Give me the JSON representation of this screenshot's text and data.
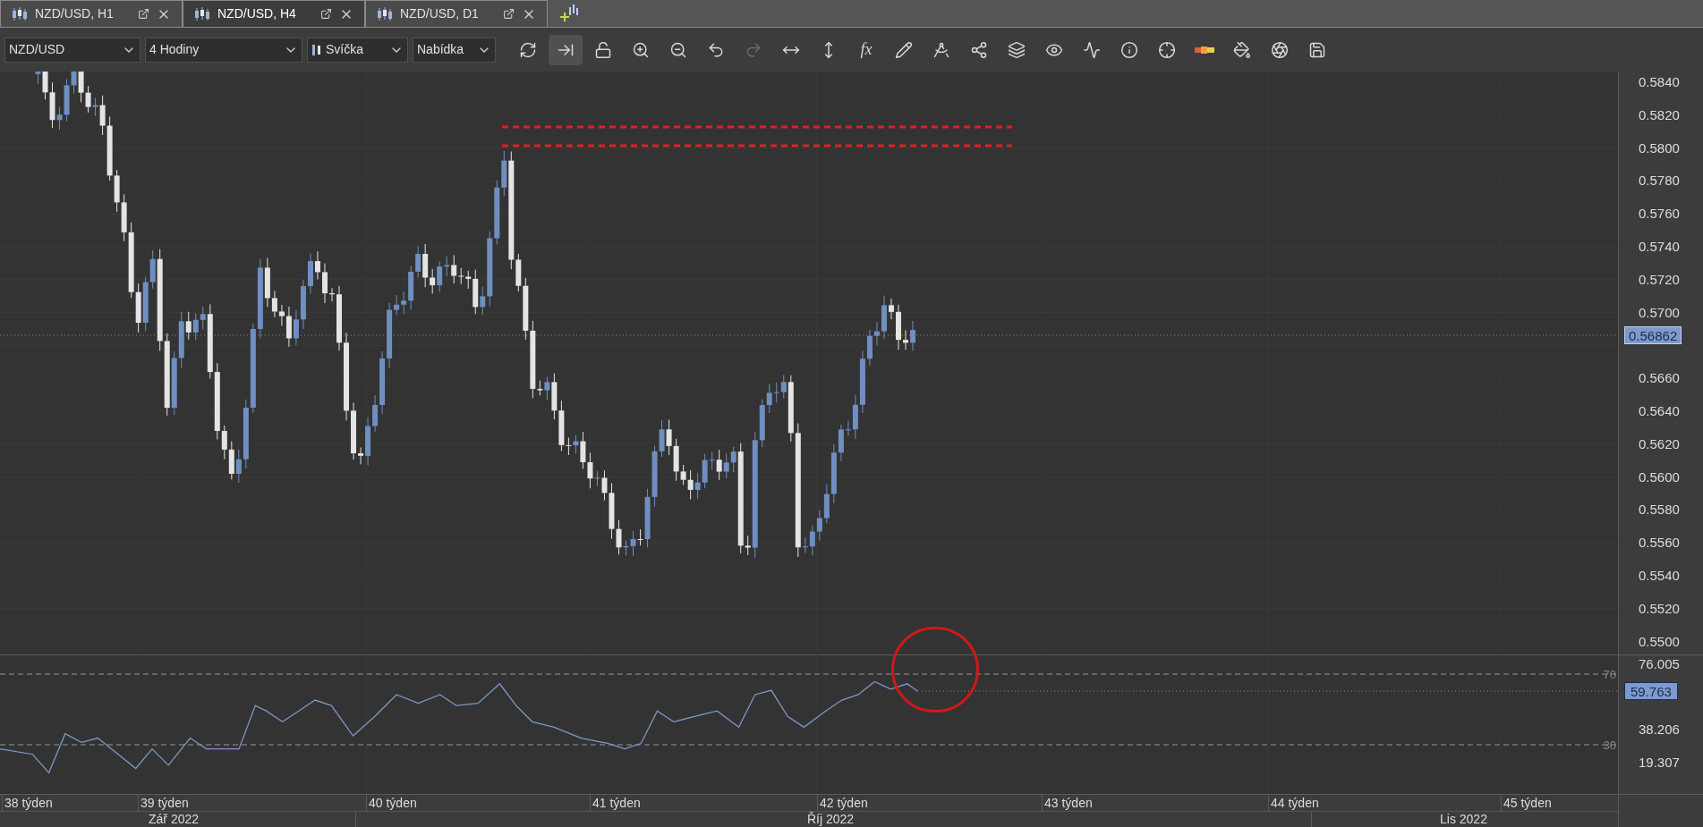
{
  "tabs": [
    {
      "label": "NZD/USD, H1",
      "selected": false
    },
    {
      "label": "NZD/USD, H4",
      "selected": true
    },
    {
      "label": "NZD/USD, D1",
      "selected": false
    }
  ],
  "toolbar": {
    "selectors": [
      {
        "value": "NZD/USD",
        "kind": "plain"
      },
      {
        "value": "4 Hodiny",
        "kind": "plain"
      },
      {
        "value": "Svíčka",
        "kind": "chart-type"
      },
      {
        "value": "Nabídka",
        "kind": "plain"
      }
    ],
    "buttons": [
      {
        "kind": "refresh",
        "active": false,
        "disabled": false
      },
      {
        "kind": "autoscroll",
        "active": true,
        "disabled": false
      },
      {
        "kind": "unlock",
        "active": false,
        "disabled": false
      },
      {
        "kind": "zoom-in",
        "active": false,
        "disabled": false
      },
      {
        "kind": "zoom-out",
        "active": false,
        "disabled": false
      },
      {
        "kind": "undo",
        "active": false,
        "disabled": false
      },
      {
        "kind": "redo",
        "active": false,
        "disabled": true
      },
      {
        "kind": "fit-horizontal",
        "active": false,
        "disabled": false
      },
      {
        "kind": "fit-vertical",
        "active": false,
        "disabled": false
      },
      {
        "kind": "function",
        "label": "fx",
        "active": false,
        "disabled": false
      },
      {
        "kind": "pencil",
        "active": false,
        "disabled": false
      },
      {
        "kind": "compass",
        "active": false,
        "disabled": false
      },
      {
        "kind": "network",
        "active": false,
        "disabled": false
      },
      {
        "kind": "layers",
        "active": false,
        "disabled": false
      },
      {
        "kind": "eye",
        "active": false,
        "disabled": false
      },
      {
        "kind": "indicator",
        "active": false,
        "disabled": false
      },
      {
        "kind": "info",
        "active": false,
        "disabled": false
      },
      {
        "kind": "crosshair",
        "active": false,
        "disabled": false
      },
      {
        "kind": "color-bar",
        "active": false,
        "disabled": false
      },
      {
        "kind": "paint-bucket",
        "active": false,
        "disabled": false
      },
      {
        "kind": "aperture",
        "active": false,
        "disabled": false
      },
      {
        "kind": "save",
        "active": false,
        "disabled": false
      }
    ]
  },
  "price_axis": {
    "labels": [
      "0.5840",
      "0.5820",
      "0.5800",
      "0.5780",
      "0.5760",
      "0.5740",
      "0.5720",
      "0.5700",
      "0.5660",
      "0.5640",
      "0.5620",
      "0.5600",
      "0.5580",
      "0.5560",
      "0.5540",
      "0.5520",
      "0.5500"
    ],
    "current_price": "0.56862"
  },
  "rsi_axis": {
    "labels": [
      "76.005",
      "38.206",
      "19.307"
    ],
    "current_value": "59.763",
    "levels": [
      "70",
      "30"
    ]
  },
  "time_axis": {
    "weeks": [
      "38 týden",
      "39 týden",
      "40 týden",
      "41 týden",
      "42 týden",
      "43 týden",
      "44 týden",
      "45 týden"
    ],
    "months": [
      "Zář 2022",
      "Říj 2022",
      "Lis 2022"
    ]
  }
}
